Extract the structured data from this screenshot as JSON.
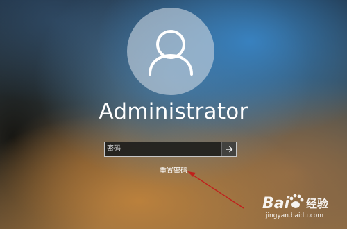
{
  "lock_screen": {
    "user_name": "Administrator",
    "avatar_icon": "user-silhouette-icon",
    "password_field": {
      "placeholder": "密码",
      "value": ""
    },
    "submit_icon": "arrow-right-icon",
    "reset_password_link": "重置密码"
  },
  "annotation": {
    "arrow_color": "#c0201c"
  },
  "watermark": {
    "logo_lettering": "Bai  经验",
    "url": "jingyan.baidu.com"
  }
}
